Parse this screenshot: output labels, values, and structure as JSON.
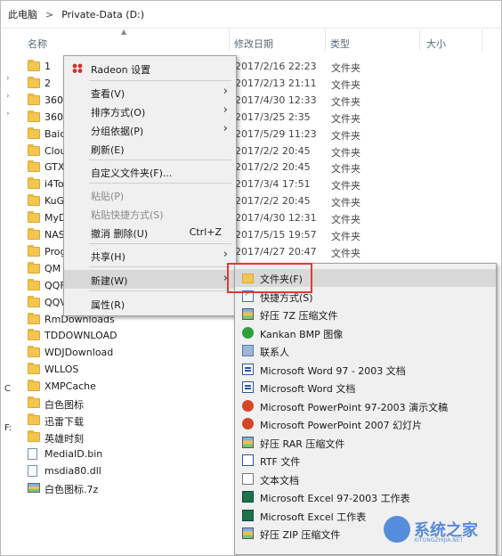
{
  "breadcrumb": {
    "root": "此电脑",
    "separator": ">",
    "drive": "Private-Data (D:)"
  },
  "columns": {
    "name": "名称",
    "date": "修改日期",
    "type": "类型",
    "size": "大小"
  },
  "files": [
    {
      "name": "1",
      "date": "2017/2/16 22:23",
      "type": "文件夹",
      "icon": "folder"
    },
    {
      "name": "2",
      "date": "2017/2/13 21:11",
      "type": "文件夹",
      "icon": "folder"
    },
    {
      "name": "360",
      "date": "2017/4/30 12:33",
      "type": "文件夹",
      "icon": "folder"
    },
    {
      "name": "360",
      "date": "2017/3/25 2:35",
      "type": "文件夹",
      "icon": "folder"
    },
    {
      "name": "Baic",
      "date": "2017/5/29 11:23",
      "type": "文件夹",
      "icon": "folder"
    },
    {
      "name": "Clou",
      "date": "2017/2/2 20:45",
      "type": "文件夹",
      "icon": "folder"
    },
    {
      "name": "GTX",
      "date": "2017/2/2 20:45",
      "type": "文件夹",
      "icon": "folder"
    },
    {
      "name": "i4To",
      "date": "2017/3/4 17:51",
      "type": "文件夹",
      "icon": "folder"
    },
    {
      "name": "KuG",
      "date": "2017/2/2 20:45",
      "type": "文件夹",
      "icon": "folder"
    },
    {
      "name": "MyD",
      "date": "2017/4/30 12:31",
      "type": "文件夹",
      "icon": "folder"
    },
    {
      "name": "NAS",
      "date": "2017/5/15 19:57",
      "type": "文件夹",
      "icon": "folder"
    },
    {
      "name": "Prog",
      "date": "2017/4/27 20:47",
      "type": "文件夹",
      "icon": "folder"
    },
    {
      "name": "QM",
      "date": "",
      "type": "",
      "icon": "folder"
    },
    {
      "name": "QQF",
      "date": "",
      "type": "",
      "icon": "folder"
    },
    {
      "name": "QQV",
      "date": "",
      "type": "",
      "icon": "folder"
    },
    {
      "name": "RmDownloads",
      "date": "",
      "type": "",
      "icon": "folder"
    },
    {
      "name": "TDDOWNLOAD",
      "date": "",
      "type": "",
      "icon": "folder"
    },
    {
      "name": "WDJDownload",
      "date": "",
      "type": "",
      "icon": "folder"
    },
    {
      "name": "WLLOS",
      "date": "",
      "type": "",
      "icon": "folder"
    },
    {
      "name": "XMPCache",
      "date": "",
      "type": "",
      "icon": "folder"
    },
    {
      "name": "白色图标",
      "date": "",
      "type": "",
      "icon": "folder"
    },
    {
      "name": "迅雷下载",
      "date": "",
      "type": "",
      "icon": "folder"
    },
    {
      "name": "英雄时刻",
      "date": "",
      "type": "",
      "icon": "folder"
    },
    {
      "name": "MediaID.bin",
      "date": "",
      "type": "",
      "icon": "file"
    },
    {
      "name": "msdia80.dll",
      "date": "",
      "type": "",
      "icon": "file"
    },
    {
      "name": "白色图标.7z",
      "date": "",
      "type": "",
      "icon": "archive"
    }
  ],
  "context_menu": {
    "radeon": "Radeon 设置",
    "view": "查看(V)",
    "sort": "排序方式(O)",
    "group": "分组依据(P)",
    "refresh": "刷新(E)",
    "customize": "自定义文件夹(F)...",
    "paste": "粘贴(P)",
    "paste_shortcut": "粘贴快捷方式(S)",
    "undo": "撤消 删除(U)",
    "undo_shortcut": "Ctrl+Z",
    "share": "共享(H)",
    "new": "新建(W)",
    "properties": "属性(R)"
  },
  "new_submenu": [
    {
      "label": "文件夹(F)",
      "icon": "folder"
    },
    {
      "label": "快捷方式(S)",
      "icon": "shortcut"
    },
    {
      "label": "好压 7Z 压缩文件",
      "icon": "archive"
    },
    {
      "label": "Kankan BMP 图像",
      "icon": "kankan"
    },
    {
      "label": "联系人",
      "icon": "contact"
    },
    {
      "label": "Microsoft Word 97 - 2003 文档",
      "icon": "word"
    },
    {
      "label": "Microsoft Word 文档",
      "icon": "word"
    },
    {
      "label": "Microsoft PowerPoint 97-2003 演示文稿",
      "icon": "ppt"
    },
    {
      "label": "Microsoft PowerPoint 2007 幻灯片",
      "icon": "ppt"
    },
    {
      "label": "好压 RAR 压缩文件",
      "icon": "archive"
    },
    {
      "label": "RTF 文件",
      "icon": "rtf"
    },
    {
      "label": "文本文档",
      "icon": "txt"
    },
    {
      "label": "Microsoft Excel 97-2003 工作表",
      "icon": "excel"
    },
    {
      "label": "Microsoft Excel 工作表",
      "icon": "excel"
    },
    {
      "label": "好压 ZIP 压缩文件",
      "icon": "archive"
    }
  ],
  "left_strip": {
    "c": "C",
    "f": "F:"
  },
  "watermark": {
    "text": "系统之家",
    "sub": "XITONGZHIJIA.NET",
    "color": "#3b7bd6"
  }
}
